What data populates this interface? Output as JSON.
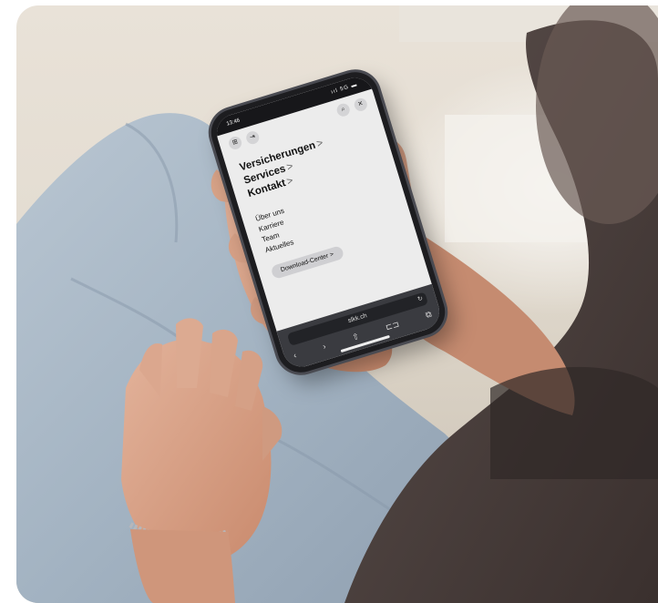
{
  "phone": {
    "status_time": "13:46",
    "status_indicators": "ııl 5G ▬",
    "menu_main": [
      {
        "label": "Versicherungen",
        "chevron": ">"
      },
      {
        "label": "Services",
        "chevron": ">"
      },
      {
        "label": "Kontakt",
        "chevron": ">"
      }
    ],
    "menu_sub": [
      "Über uns",
      "Karriere",
      "Team",
      "Aktuelles"
    ],
    "download_button": "Download-Center  >",
    "url": "slkk.ch",
    "icons": {
      "menu": "⊞",
      "login": "⇥",
      "search": "⌕",
      "close": "✕",
      "reload": "↻",
      "back": "‹",
      "forward": "›",
      "share": "⇧",
      "bookmarks": "⊏⊐",
      "tabs": "⧉"
    }
  },
  "colors": {
    "screen_bg": "#ececec",
    "toolbar_bg": "#3a3b40",
    "button_bg": "#cfcfd2",
    "shirt": "#4d4240",
    "jeans": "#a7b6c4",
    "skin": "#d49d82"
  }
}
